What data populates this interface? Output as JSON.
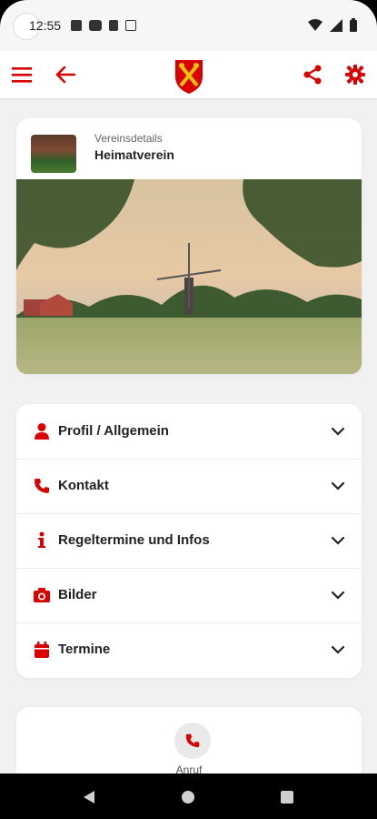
{
  "status": {
    "time": "12:55"
  },
  "appbar": {
    "logo_name": "town-crest-logo"
  },
  "club": {
    "subtitle": "Vereinsdetails",
    "name": "Heimatverein"
  },
  "sections": [
    {
      "label": "Profil / Allgemein",
      "icon": "person-icon"
    },
    {
      "label": "Kontakt",
      "icon": "phone-icon"
    },
    {
      "label": "Regeltermine und Infos",
      "icon": "info-icon"
    },
    {
      "label": "Bilder",
      "icon": "camera-icon"
    },
    {
      "label": "Termine",
      "icon": "calendar-icon"
    }
  ],
  "actions": {
    "call_label": "Anruf"
  },
  "colors": {
    "accent": "#d90000",
    "background": "#f1f1f1",
    "card": "#ffffff"
  }
}
